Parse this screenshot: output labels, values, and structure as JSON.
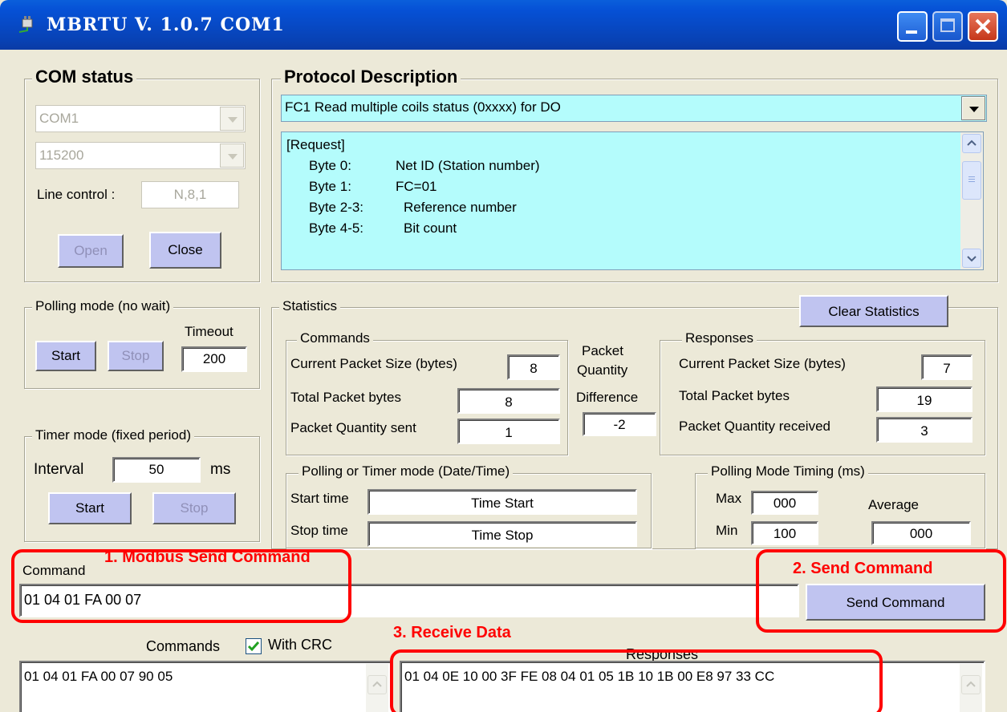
{
  "window": {
    "title": "MBRTU  V. 1.0.7  COM1"
  },
  "com_status": {
    "title": "COM status",
    "port": "COM1",
    "baud": "115200",
    "line_control_label": "Line control :",
    "line_control_value": "N,8,1",
    "open_label": "Open",
    "close_label": "Close"
  },
  "protocol": {
    "title": "Protocol Description",
    "selected": "FC1  Read multiple coils status (0xxxx)  for DO",
    "lines": [
      {
        "a": "[Request]",
        "b": ""
      },
      {
        "a": "Byte 0:",
        "b": "Net ID (Station number)"
      },
      {
        "a": "Byte 1:",
        "b": "FC=01"
      },
      {
        "a": "Byte 2-3:",
        "b": "Reference number"
      },
      {
        "a": "Byte 4-5:",
        "b": "Bit count"
      }
    ]
  },
  "polling": {
    "title": "Polling mode (no wait)",
    "timeout_label": "Timeout",
    "timeout": "200",
    "start_label": "Start",
    "stop_label": "Stop"
  },
  "timer": {
    "title": "Timer mode (fixed period)",
    "interval_label": "Interval",
    "interval": "50",
    "unit": "ms",
    "start_label": "Start",
    "stop_label": "Stop"
  },
  "statistics": {
    "title": "Statistics",
    "clear_label": "Clear Statistics",
    "commands": {
      "title": "Commands",
      "size_label": "Current Packet Size (bytes)",
      "size": "8",
      "total_label": "Total Packet bytes",
      "total": "8",
      "qty_label": "Packet Quantity sent",
      "qty": "1"
    },
    "difference": {
      "label1": "Packet",
      "label2": "Quantity",
      "label3": "Difference",
      "value": "-2"
    },
    "responses": {
      "title": "Responses",
      "size_label": "Current Packet Size (bytes)",
      "size": "7",
      "total_label": "Total Packet bytes",
      "total": "19",
      "qty_label": "Packet Quantity received",
      "qty": "3"
    },
    "datetime": {
      "title": "Polling  or Timer mode  (Date/Time)",
      "start_label": "Start time",
      "start_value": "Time Start",
      "stop_label": "Stop time",
      "stop_value": "Time Stop"
    },
    "timing": {
      "title": "Polling Mode Timing (ms)",
      "max_label": "Max",
      "max": "000",
      "min_label": "Min",
      "min": "100",
      "avg_label": "Average",
      "avg": "000"
    }
  },
  "command": {
    "label": "Command",
    "value": "01 04 01 FA 00 07",
    "send_label": "Send Command"
  },
  "log": {
    "commands_label": "Commands",
    "with_crc_label": "With CRC",
    "responses_label": "Responses",
    "commands_text": "01 04 01 FA 00 07 90 05",
    "responses_text": "01 04 0E 10 00 3F FE 08 04 01 05 1B 10 1B 00 E8 97 33 CC"
  },
  "annotations": {
    "a1": "1. Modbus Send Command",
    "a2": "2. Send Command",
    "a3": "3. Receive Data",
    "color": "#ff0000"
  }
}
